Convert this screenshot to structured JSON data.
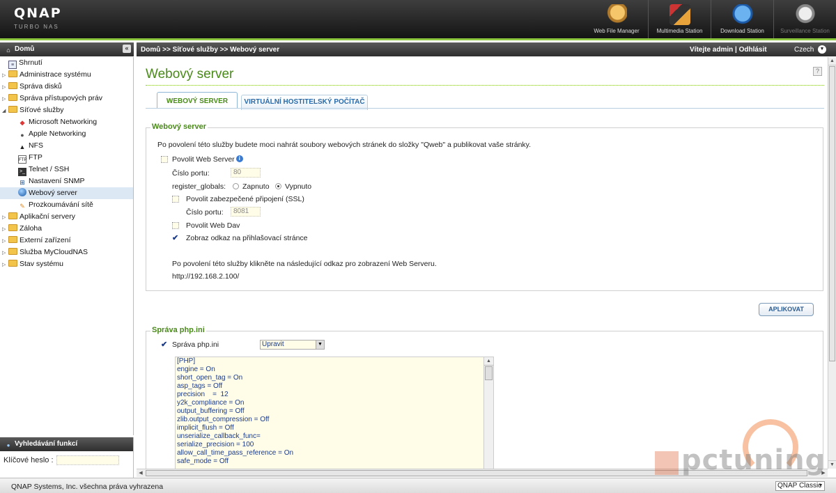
{
  "header": {
    "logo": "QNAP",
    "logo_sub": "TURBO NAS",
    "apps": [
      {
        "label": "Web File Manager",
        "icon": "web-file-manager-icon"
      },
      {
        "label": "Multimedia Station",
        "icon": "multimedia-station-icon"
      },
      {
        "label": "Download Station",
        "icon": "download-station-icon"
      },
      {
        "label": "Surveillance Station",
        "icon": "surveillance-station-icon"
      }
    ]
  },
  "sidebar": {
    "title": "Domů",
    "items": [
      {
        "label": "Shrnutí"
      },
      {
        "label": "Administrace systému"
      },
      {
        "label": "Správa disků"
      },
      {
        "label": "Správa přístupových práv"
      },
      {
        "label": "Síťové služby"
      },
      {
        "label": "Microsoft Networking"
      },
      {
        "label": "Apple Networking"
      },
      {
        "label": "NFS"
      },
      {
        "label": "FTP"
      },
      {
        "label": "Telnet / SSH"
      },
      {
        "label": "Nastavení SNMP"
      },
      {
        "label": "Webový server"
      },
      {
        "label": "Prozkoumávání sítě"
      },
      {
        "label": "Aplikační servery"
      },
      {
        "label": "Záloha"
      },
      {
        "label": "Externí zařízení"
      },
      {
        "label": "Služba MyCloudNAS"
      },
      {
        "label": "Stav systému"
      }
    ],
    "search_title": "Vyhledávání funkcí",
    "search_label": "Klíčové heslo :"
  },
  "topnav": {
    "breadcrumb": "Domů >> Síťové služby >> Webový server",
    "welcome": "Vítejte admin | Odhlásit",
    "language": "Czech"
  },
  "main": {
    "title": "Webový server",
    "tabs": [
      {
        "label": "WEBOVÝ SERVER"
      },
      {
        "label": "VIRTUÁLNÍ HOSTITELSKÝ POČÍTAČ"
      }
    ],
    "webserver": {
      "legend": "Webový server",
      "intro": "Po povolení této služby budete moci nahrát soubory webových stránek do složky \"Qweb\" a publikovat vaše stránky.",
      "enable_label": "Povolit Web Server",
      "port_label": "Číslo portu:",
      "port_value": "80",
      "register_globals_label": "register_globals:",
      "radio_on": "Zapnuto",
      "radio_off": "Vypnuto",
      "ssl_label": "Povolit zabezpečené připojení (SSL)",
      "ssl_port_label": "Číslo portu:",
      "ssl_port_value": "8081",
      "webdav_label": "Povolit Web Dav",
      "show_link_label": "Zobraz odkaz na přihlašovací stránce",
      "link_intro": "Po povolení této služby klikněte na následující odkaz pro zobrazení Web Serveru.",
      "link_url": "http://192.168.2.100/"
    },
    "apply_label": "APLIKOVAT",
    "php": {
      "legend": "Správa php.ini",
      "checkbox_label": "Správa php.ini",
      "select_value": "Upravit",
      "ini_lines": [
        "[PHP]",
        "engine = On",
        "short_open_tag = On",
        "asp_tags = Off",
        "precision    =  12",
        "y2k_compliance = On",
        "output_buffering = Off",
        "zlib.output_compression = Off",
        "implicit_flush = Off",
        "unserialize_callback_func=",
        "serialize_precision = 100",
        "allow_call_time_pass_reference = On",
        "safe_mode = Off"
      ]
    }
  },
  "footer": {
    "copyright": "QNAP Systems, Inc. všechna práva vyhrazena",
    "theme": "QNAP Classic"
  },
  "watermark": {
    "text": "pctuning"
  },
  "colors": {
    "accent": "#8dc63f",
    "title_green": "#4a8a1a",
    "link_blue": "#2a6aa8"
  }
}
